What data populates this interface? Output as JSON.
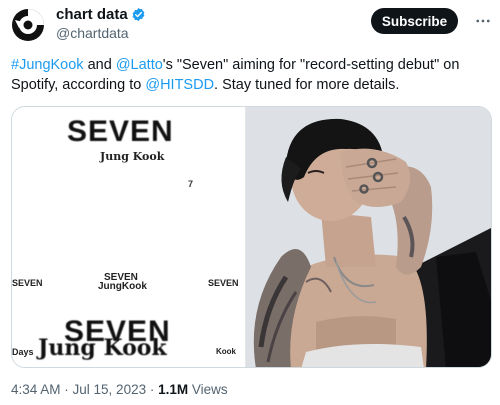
{
  "account": {
    "display_name": "chart data",
    "handle": "@chartdata",
    "verified": true,
    "avatar_icon": "chart-data-logo-icon"
  },
  "header": {
    "subscribe_label": "Subscribe",
    "more_icon": "more-options-icon"
  },
  "tweet": {
    "hashtag": "#JungKook",
    "text_and": " and ",
    "mention_1": "@Latto",
    "text_1": "'s \"Seven\" aiming for \"record-setting debut\" on Spotify, according to ",
    "mention_2": "@HITSDD",
    "text_2": ". Stay tuned for more details."
  },
  "media": {
    "album_cover": {
      "title_top": "SEVEN",
      "artist_top": "Jung Kook",
      "track_number": "7",
      "row_left": "SEVEN",
      "row_mid_a": "SEVEN",
      "row_mid_b": "JungKook",
      "row_right": "SEVEN",
      "title_bottom": "SEVEN",
      "artist_bottom": "Jung Kook",
      "days_label": "Days",
      "small_artist": "Kook"
    },
    "photo": "artist-photo"
  },
  "footer": {
    "time": "4:34 AM",
    "separator": " · ",
    "date": "Jul 15, 2023",
    "views_count": "1.1M",
    "views_label": " Views"
  },
  "colors": {
    "link": "#1d9bf0",
    "verified": "#1d9bf0",
    "subscribe_bg": "#0f1419",
    "muted_text": "#536471"
  }
}
